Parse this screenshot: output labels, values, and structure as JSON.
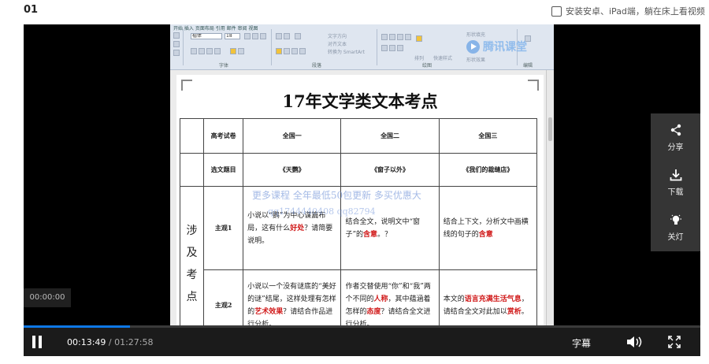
{
  "page": {
    "episode_title": "01",
    "app_promo": "安装安卓、iPad端，躺在床上看视频"
  },
  "video_frame": {
    "ribbon": {
      "tabs": "开始    插入    页面布局    引用    邮件    审阅    视图",
      "font_name": "楷体",
      "font_size": "18",
      "group_font": "字体",
      "group_paragraph": "段落",
      "group_drawing": "绘图",
      "group_edit": "编辑",
      "text_direction": "文字方向",
      "align_text": "对齐文本",
      "smartart": "转换为 SmartArt",
      "quick_style": "快速样式",
      "shape_fill": "形状填充",
      "shape_outline": "形状轮廓",
      "shape_effect": "形状效果",
      "arrange": "排列",
      "logo_text": "腾讯课堂"
    },
    "document": {
      "title": "17年文学类文本考点",
      "table": {
        "col_label": "高考试卷",
        "col_headers": [
          "全国一",
          "全国二",
          "全国三"
        ],
        "row2_label": "选文题目",
        "row2_cells": [
          "《天鹦》",
          "《窗子以外》",
          "《我们的裁缝店》"
        ],
        "side_label": "涉及考点",
        "rows": [
          {
            "label": "主观1",
            "c1": [
              "小说以“鹦”为中心谋篇布局，这有什么",
              "好处",
              "？请简要说明。"
            ],
            "c2": [
              "结合全文，说明文中“窗子”的",
              "含意",
              "。？"
            ],
            "c3": [
              "结合上下文，分析文中画横线的句子的",
              "含意",
              ""
            ]
          },
          {
            "label": "主观2",
            "c1": [
              "小说以一个没有谜底的“美好的谜”结尾，这样处理有怎样的",
              "艺术效果",
              "？请结合作品进行分析。"
            ],
            "c2": [
              "作者交替使用“你”和“我”两个不同的",
              "人称",
              "，其中蕴涵着怎样的",
              "态度",
              "？请结合全文进行分析。"
            ],
            "c3": [
              "本文的",
              "语言充满生活气息",
              "，请结合全文对此加以",
              "赏析",
              "。"
            ]
          }
        ]
      },
      "overlay_watermark": "更多课程    全年最低50包更新    多买优惠大",
      "overlay_qq": "qq1744440408    qq82794"
    }
  },
  "player": {
    "hover_time": "00:00:00",
    "current_time": "00:13:49",
    "duration": "/ 01:27:58",
    "progress_percent": 15.7,
    "subtitle_label": "字幕",
    "side_actions": [
      {
        "label": "分享",
        "icon": "share-icon"
      },
      {
        "label": "下载",
        "icon": "download-icon"
      },
      {
        "label": "关灯",
        "icon": "lightbulb-icon"
      }
    ],
    "colors": {
      "progress": "#0e78e6",
      "emphasis_red": "#d01818"
    }
  }
}
